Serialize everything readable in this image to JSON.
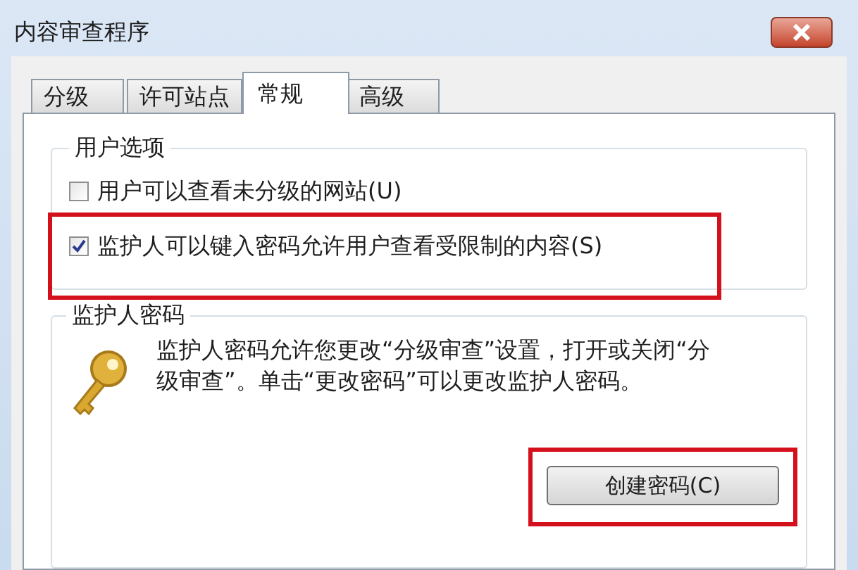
{
  "window": {
    "title": "内容审查程序"
  },
  "tabs": [
    {
      "label": "分级",
      "selected": false
    },
    {
      "label": "许可站点",
      "selected": false
    },
    {
      "label": "常规",
      "selected": true
    },
    {
      "label": "高级",
      "selected": false
    }
  ],
  "user_options": {
    "title": "用户选项",
    "options": [
      {
        "label": "用户可以查看未分级的网站(U)",
        "checked": false,
        "highlighted": false
      },
      {
        "label": "监护人可以键入密码允许用户查看受限制的内容(S)",
        "checked": true,
        "highlighted": true
      }
    ]
  },
  "supervisor_password": {
    "title": "监护人密码",
    "description": "监护人密码允许您更改“分级审查”设置，打开或关闭“分级审查”。单击“更改密码”可以更改监护人密码。",
    "button": {
      "label": "创建密码(C)",
      "highlighted": true
    }
  }
}
